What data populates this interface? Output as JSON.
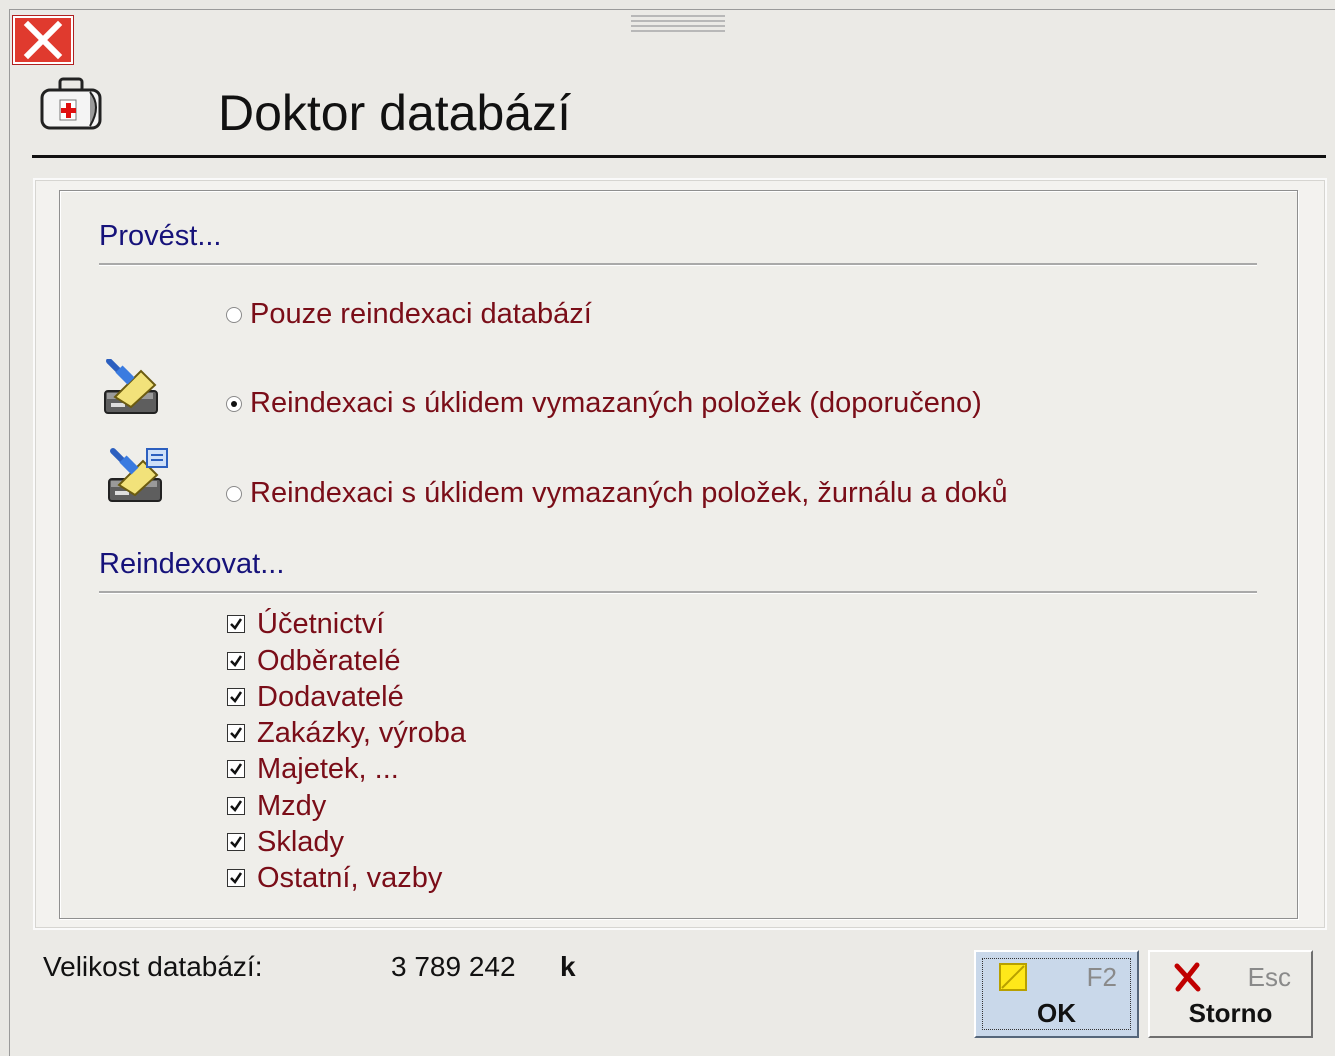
{
  "window": {
    "title": "Doktor databází",
    "icons": {
      "close": "close-icon",
      "app": "doctor-bag-icon"
    }
  },
  "sections": {
    "perform": {
      "title": "Provést...",
      "options": [
        {
          "label": "Pouze reindexaci databází",
          "selected": false
        },
        {
          "label": "Reindexaci s úklidem vymazaných položek (doporučeno)",
          "selected": true,
          "icon": "broom-database-icon"
        },
        {
          "label": "Reindexaci s úklidem vymazaných položek, žurnálu a doků",
          "selected": false,
          "icon": "broom-database-journal-icon"
        }
      ]
    },
    "reindex": {
      "title": "Reindexovat...",
      "items": [
        {
          "label": "Účetnictví",
          "checked": true
        },
        {
          "label": "Odběratelé",
          "checked": true
        },
        {
          "label": "Dodavatelé",
          "checked": true
        },
        {
          "label": "Zakázky, výroba",
          "checked": true
        },
        {
          "label": "Majetek, ...",
          "checked": true
        },
        {
          "label": "Mzdy",
          "checked": true
        },
        {
          "label": "Sklady",
          "checked": true
        },
        {
          "label": "Ostatní, vazby",
          "checked": true
        }
      ]
    }
  },
  "status": {
    "label": "Velikost databází:",
    "value": "3 789 242",
    "unit": "k"
  },
  "buttons": {
    "ok": {
      "label": "OK",
      "shortcut": "F2",
      "icon": "yellow-flag-icon"
    },
    "cancel": {
      "label": "Storno",
      "shortcut": "Esc",
      "icon": "red-x-icon"
    }
  },
  "colors": {
    "section_title": "#16127a",
    "option_text": "#7a0d18",
    "close_button": "#e03a2e",
    "ok_button": "#c9d8ea"
  }
}
